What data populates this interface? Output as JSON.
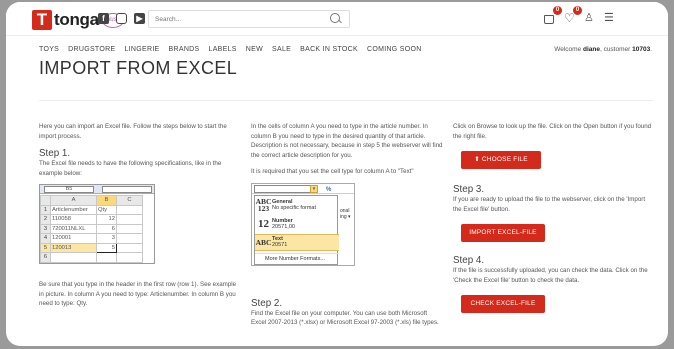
{
  "header": {
    "logo_text": "tonga",
    "logo_letter": "T",
    "logo_sub": "blush",
    "social": [
      "f",
      "◎",
      "▶"
    ],
    "search_placeholder": "Search...",
    "cart_count": "0",
    "wishlist_count": "0",
    "icons": [
      "bag-icon",
      "heart-icon",
      "user-icon",
      "filter-icon",
      "search-icon",
      "facebook-icon",
      "instagram-icon",
      "youtube-icon"
    ]
  },
  "nav": {
    "items": [
      "TOYS",
      "DRUGSTORE",
      "LINGERIE",
      "BRANDS",
      "LABELS",
      "NEW",
      "SALE",
      "BACK IN STOCK",
      "COMING SOON"
    ],
    "welcome_prefix": "Welcome ",
    "user_name": "diane",
    "welcome_mid": ", customer ",
    "customer_no": "10703",
    "welcome_suffix": "."
  },
  "page": {
    "title": "IMPORT FROM EXCEL"
  },
  "col1": {
    "intro": "Here you can import an Excel file. Follow the steps below to start the import process.",
    "step_title": "Step 1.",
    "step_text": "The Excel file needs to have the following specifications, like in the example below:",
    "footer": "Be sure that you type in the header in the first row (row 1). See example in picture. In column A you need to type: Articlenumber. In column B you need to type: Qty."
  },
  "excel1": {
    "namebox": "B5",
    "columns": [
      "A",
      "B",
      "C"
    ],
    "rows": [
      {
        "n": "1",
        "a": "Articlenumber",
        "b": "Qty"
      },
      {
        "n": "2",
        "a": "110058",
        "b": "12"
      },
      {
        "n": "3",
        "a": "720011NLXL",
        "b": "6"
      },
      {
        "n": "4",
        "a": "120001",
        "b": "3"
      },
      {
        "n": "5",
        "a": "120013",
        "b": "5"
      },
      {
        "n": "6",
        "a": "",
        "b": ""
      }
    ]
  },
  "col2": {
    "text1": "In the cells of column A you need to type in the article number. In column B you need to type in the desired quantity of that article. Description is not necessary, because in step 5 the webserver will find the correct article description for you.",
    "text2": "It is required that you set the cell type for column A to \"Text\"",
    "step_title": "Step 2.",
    "step_text": "Find the Excel file on your computer. You can use both Microsoft Excel 2007-2013 (*.xlsx) or Microsoft Excel 97-2003 (*.xls) file types."
  },
  "excel2": {
    "items": [
      {
        "icon": "ABC 123",
        "title": "General",
        "sub": "No specific format"
      },
      {
        "icon": "12",
        "title": "Number",
        "sub": "20571,00"
      },
      {
        "icon": "ABC",
        "title": "Text",
        "sub": "20571"
      }
    ],
    "more": "More Number Formats...",
    "side_a": "onal",
    "side_b": "ing ▾"
  },
  "col3": {
    "intro": "Click on Browse to look up the file. Click on the Open button if you found the right file.",
    "choose_button": "CHOOSE FILE",
    "step3_title": "Step 3.",
    "step3_text": "If you are ready to upload the file to the webserver, click on the 'Import the Excel file' button.",
    "import_button": "IMPORT EXCEL-FILE",
    "step4_title": "Step 4.",
    "step4_text": "If the file is successfully uploaded, you can check the data. Click on the 'Check the Excel file' button to check the data.",
    "check_button": "CHECK EXCEL-FILE"
  },
  "colors": {
    "accent": "#d42a1b",
    "highlight": "#fbd97b"
  }
}
